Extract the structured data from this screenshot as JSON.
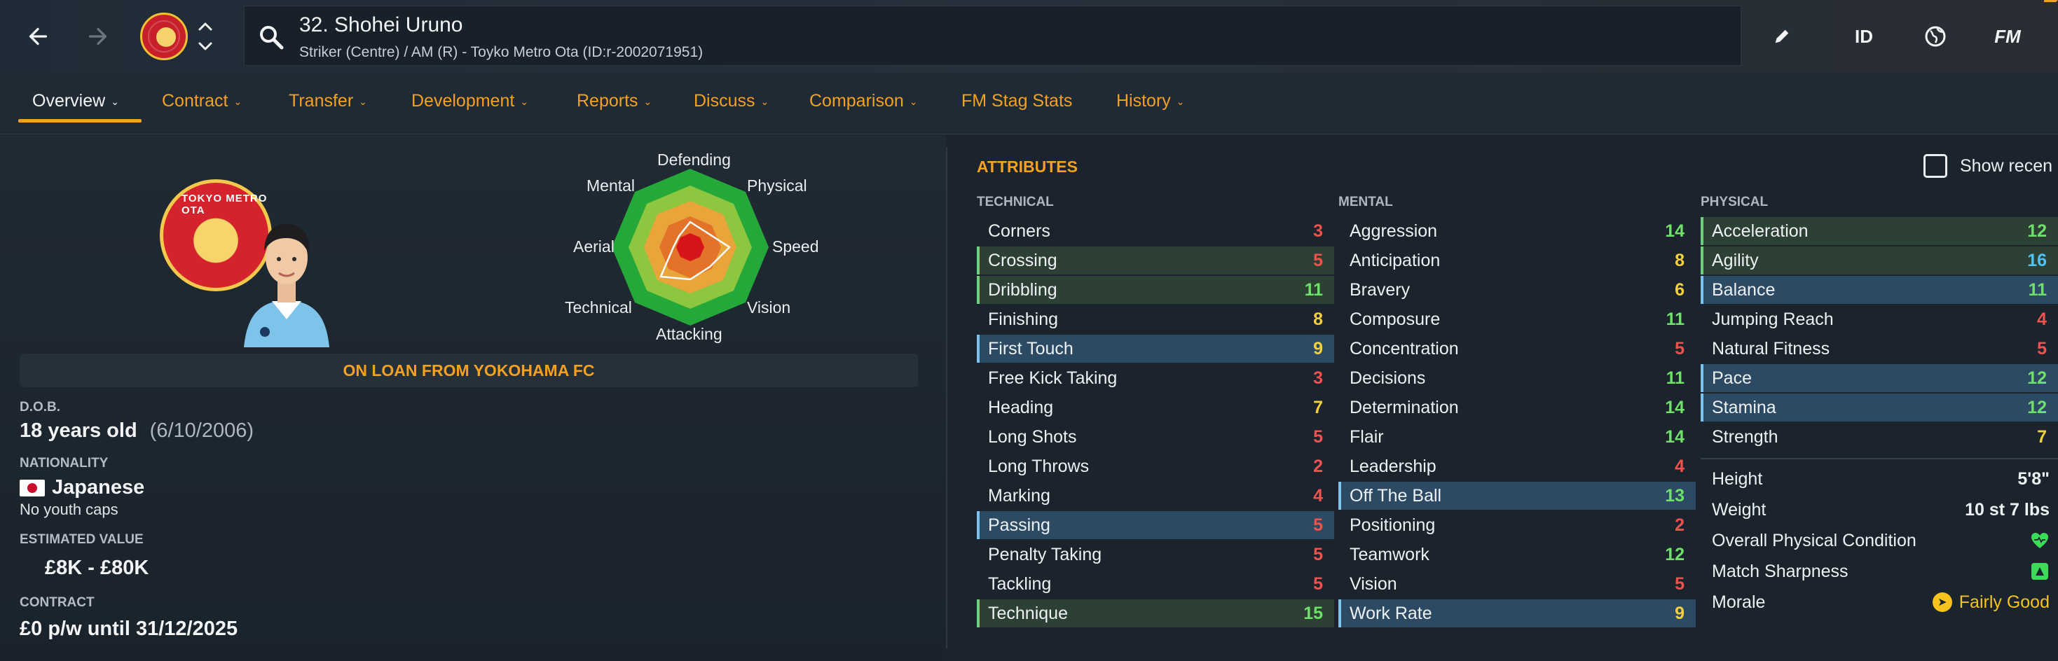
{
  "header": {
    "player_name": "32. Shohei Uruno",
    "player_subtitle": "Striker (Centre) / AM (R) - Toyko Metro Ota (ID:r-2002071951)",
    "id_label": "ID",
    "fm_label": "FM"
  },
  "tabs": [
    {
      "label": "Overview",
      "active": true,
      "dropdown": true
    },
    {
      "label": "Contract",
      "dropdown": true
    },
    {
      "label": "Transfer",
      "dropdown": true
    },
    {
      "label": "Development",
      "dropdown": true
    },
    {
      "label": "Reports",
      "dropdown": true
    },
    {
      "label": "Discuss",
      "dropdown": true
    },
    {
      "label": "Comparison",
      "dropdown": true
    },
    {
      "label": "FM Stag Stats",
      "dropdown": false
    },
    {
      "label": "History",
      "dropdown": true
    }
  ],
  "club_badge_text": "TOKYO METRO OTA",
  "radar": {
    "labels": [
      "Defending",
      "Physical",
      "Speed",
      "Vision",
      "Attacking",
      "Technical",
      "Aerial",
      "Mental"
    ]
  },
  "profile": {
    "loan_banner": "ON LOAN FROM YOKOHAMA FC",
    "dob_label": "D.O.B.",
    "dob_age": "18 years old",
    "dob_date": "(6/10/2006)",
    "nationality_label": "NATIONALITY",
    "nationality": "Japanese",
    "youth_caps": "No youth caps",
    "value_label": "ESTIMATED VALUE",
    "value": "£8K - £80K",
    "contract_label": "CONTRACT",
    "contract": "£0 p/w until 31/12/2025"
  },
  "attributes": {
    "title": "ATTRIBUTES",
    "show_recent": "Show recen",
    "colors": {
      "low": "#f0524e",
      "mid": "#f4d03f",
      "high": "#6fe06a",
      "top": "#4fc3f7"
    },
    "technical": {
      "title": "TECHNICAL",
      "rows": [
        {
          "name": "Corners",
          "value": "3",
          "hl": ""
        },
        {
          "name": "Crossing",
          "value": "5",
          "hl": "green"
        },
        {
          "name": "Dribbling",
          "value": "11",
          "hl": "green"
        },
        {
          "name": "Finishing",
          "value": "8",
          "hl": ""
        },
        {
          "name": "First Touch",
          "value": "9",
          "hl": "blue"
        },
        {
          "name": "Free Kick Taking",
          "value": "3",
          "hl": ""
        },
        {
          "name": "Heading",
          "value": "7",
          "hl": ""
        },
        {
          "name": "Long Shots",
          "value": "5",
          "hl": ""
        },
        {
          "name": "Long Throws",
          "value": "2",
          "hl": ""
        },
        {
          "name": "Marking",
          "value": "4",
          "hl": ""
        },
        {
          "name": "Passing",
          "value": "5",
          "hl": "blue"
        },
        {
          "name": "Penalty Taking",
          "value": "5",
          "hl": ""
        },
        {
          "name": "Tackling",
          "value": "5",
          "hl": ""
        },
        {
          "name": "Technique",
          "value": "15",
          "hl": "green"
        }
      ]
    },
    "mental": {
      "title": "MENTAL",
      "rows": [
        {
          "name": "Aggression",
          "value": "14",
          "hl": ""
        },
        {
          "name": "Anticipation",
          "value": "8",
          "hl": ""
        },
        {
          "name": "Bravery",
          "value": "6",
          "hl": ""
        },
        {
          "name": "Composure",
          "value": "11",
          "hl": ""
        },
        {
          "name": "Concentration",
          "value": "5",
          "hl": ""
        },
        {
          "name": "Decisions",
          "value": "11",
          "hl": ""
        },
        {
          "name": "Determination",
          "value": "14",
          "hl": ""
        },
        {
          "name": "Flair",
          "value": "14",
          "hl": ""
        },
        {
          "name": "Leadership",
          "value": "4",
          "hl": ""
        },
        {
          "name": "Off The Ball",
          "value": "13",
          "hl": "blue"
        },
        {
          "name": "Positioning",
          "value": "2",
          "hl": ""
        },
        {
          "name": "Teamwork",
          "value": "12",
          "hl": ""
        },
        {
          "name": "Vision",
          "value": "5",
          "hl": ""
        },
        {
          "name": "Work Rate",
          "value": "9",
          "hl": "blue"
        }
      ]
    },
    "physical": {
      "title": "PHYSICAL",
      "rows": [
        {
          "name": "Acceleration",
          "value": "12",
          "hl": "green"
        },
        {
          "name": "Agility",
          "value": "16",
          "hl": "green"
        },
        {
          "name": "Balance",
          "value": "11",
          "hl": "blue"
        },
        {
          "name": "Jumping Reach",
          "value": "4",
          "hl": ""
        },
        {
          "name": "Natural Fitness",
          "value": "5",
          "hl": ""
        },
        {
          "name": "Pace",
          "value": "12",
          "hl": "blue"
        },
        {
          "name": "Stamina",
          "value": "12",
          "hl": "blue"
        },
        {
          "name": "Strength",
          "value": "7",
          "hl": ""
        }
      ]
    },
    "info": {
      "height_label": "Height",
      "height": "5'8\"",
      "weight_label": "Weight",
      "weight": "10 st 7 lbs",
      "condition_label": "Overall Physical Condition",
      "sharpness_label": "Match Sharpness",
      "morale_label": "Morale",
      "morale": "Fairly Good"
    }
  }
}
